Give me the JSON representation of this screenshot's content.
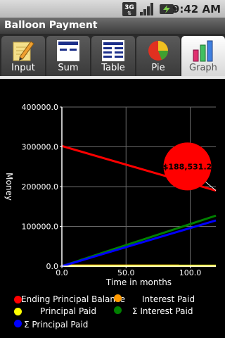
{
  "status_bar": {
    "time": "9:42 AM",
    "network_label": "3G",
    "icons": [
      "network-3g-icon",
      "signal-strength-icon",
      "battery-charging-icon"
    ]
  },
  "app": {
    "title": "Balloon Payment"
  },
  "tabs": [
    {
      "label": "Input",
      "icon": "pencil-notepad-icon",
      "selected": false
    },
    {
      "label": "Sum",
      "icon": "sum-lines-icon",
      "selected": false
    },
    {
      "label": "Table",
      "icon": "table-lines-icon",
      "selected": false
    },
    {
      "label": "Pie",
      "icon": "pie-chart-icon",
      "selected": false
    },
    {
      "label": "Graph",
      "icon": "bar-graph-icon",
      "selected": true
    }
  ],
  "chart_data": {
    "type": "line",
    "xlabel": "Time in months",
    "ylabel": "Money",
    "xlim": [
      0,
      120
    ],
    "ylim": [
      0,
      400000
    ],
    "xticks": [
      0,
      50,
      100
    ],
    "xtick_labels": [
      "0.0",
      "50.0",
      "100.0"
    ],
    "yticks": [
      0,
      100000,
      200000,
      300000,
      400000
    ],
    "ytick_labels": [
      "0.0",
      "100000.0",
      "200000.0",
      "300000.0",
      "400000.0"
    ],
    "grid": true,
    "legend_placement": "bottom",
    "series": [
      {
        "name": "Ending Principal Balance",
        "color": "#ff0000",
        "x": [
          0,
          120
        ],
        "y": [
          302000,
          190000
        ]
      },
      {
        "name": "Interest Paid",
        "color": "#ff9900",
        "x": [
          0,
          120
        ],
        "y": [
          1500,
          1300
        ]
      },
      {
        "name": "Principal Paid",
        "color": "#ffff00",
        "x": [
          0,
          120
        ],
        "y": [
          800,
          1100
        ]
      },
      {
        "name": "Σ Interest Paid",
        "color": "#008000",
        "x": [
          0,
          120
        ],
        "y": [
          0,
          127000
        ]
      },
      {
        "name": "Σ Principal Paid",
        "color": "#0000ff",
        "x": [
          0,
          120
        ],
        "y": [
          0,
          115000
        ]
      }
    ],
    "annotation": {
      "text": "$188,531.2",
      "x": 100,
      "y": 240000,
      "pointer_x": 120,
      "pointer_y": 190000,
      "color": "#ff0000"
    }
  }
}
